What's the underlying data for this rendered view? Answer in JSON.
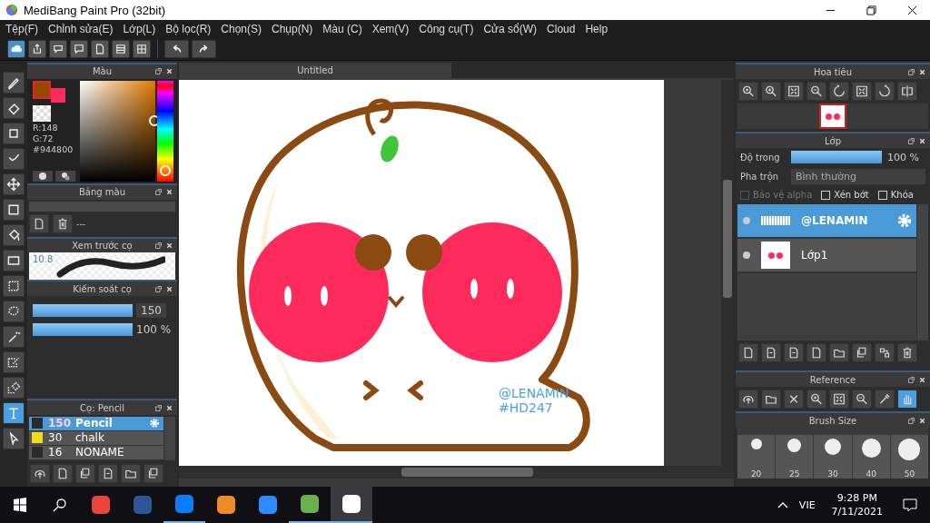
{
  "window": {
    "title": "MediBang Paint Pro (32bit)"
  },
  "menu": [
    "Tệp(F)",
    "Chỉnh sửa(E)",
    "Lớp(L)",
    "Bộ lọc(R)",
    "Chọn(S)",
    "Chụp(N)",
    "Màu (C)",
    "Xem(V)",
    "Công cụ(T)",
    "Cửa sổ(W)",
    "Cloud",
    "Help"
  ],
  "tools": [
    {
      "kind": "brush",
      "selected": false
    },
    {
      "kind": "eraser",
      "selected": false
    },
    {
      "kind": "square",
      "selected": false
    },
    {
      "kind": "dots",
      "selected": false
    },
    {
      "kind": "move",
      "selected": false
    },
    {
      "kind": "fill",
      "selected": false
    },
    {
      "kind": "bucket",
      "selected": false
    },
    {
      "kind": "gradient",
      "selected": false
    },
    {
      "kind": "select",
      "selected": false
    },
    {
      "kind": "lasso",
      "selected": false
    },
    {
      "kind": "wand",
      "selected": false
    },
    {
      "kind": "selpen",
      "selected": false
    },
    {
      "kind": "selerase",
      "selected": false
    },
    {
      "kind": "text",
      "selected": true
    },
    {
      "kind": "operation",
      "selected": false
    }
  ],
  "color_panel": {
    "title": "Màu",
    "r": "R:148",
    "g": "G:72",
    "hex": "#944800",
    "color": "#944800",
    "hue": {
      "level": 0.04
    }
  },
  "palette_panel": {
    "title": "Bảng màu",
    "name": "---"
  },
  "brush_preview": {
    "title": "Xem trước cọ",
    "size": "10.8"
  },
  "brush_control": {
    "title": "Kiếm soát cọ",
    "sliders": [
      {
        "kind": "box",
        "level": 1,
        "value": "150"
      },
      {
        "kind": "plain",
        "level": 1,
        "value": "100 %"
      }
    ]
  },
  "brushes": {
    "title": "Cọ: Pencil",
    "items": [
      {
        "size": "150",
        "name": "Pencil",
        "color": "#2b2b2b",
        "selected": true
      },
      {
        "size": "30",
        "name": "chalk",
        "color": "#f2dc17",
        "selected": false
      },
      {
        "size": "16",
        "name": "NONAME",
        "color": "#2b2b2b",
        "selected": false
      }
    ]
  },
  "canvas": {
    "tab": "Untitled",
    "texts": [
      "@LENAMIN",
      "#HD247"
    ]
  },
  "navigator": {
    "title": "Hoa tiêu"
  },
  "layer_panel": {
    "title": "Lớp",
    "opacity_label": "Độ trong",
    "opacity": {
      "level": 1,
      "value": "100 %"
    },
    "blend_label": "Pha trộn",
    "blend": "Bình thường",
    "options": [
      {
        "label": "Bảo vệ alpha",
        "checked": false,
        "disabled": true
      },
      {
        "label": "Xén bớt",
        "checked": false,
        "disabled": false
      },
      {
        "label": "Khóa",
        "checked": false,
        "disabled": false
      }
    ],
    "layers": [
      {
        "name": "@LENAMIN",
        "kind": "text",
        "selected": true
      },
      {
        "name": "Lớp1",
        "kind": "art",
        "selected": false
      }
    ]
  },
  "reference": {
    "title": "Reference"
  },
  "brush_size": {
    "title": "Brush Size",
    "sizes": [
      "20",
      "25",
      "30",
      "40",
      "50"
    ]
  },
  "taskbar": {
    "apps": [
      {
        "kind": "chrome",
        "running": false,
        "selected": false
      },
      {
        "kind": "word",
        "running": false,
        "selected": false
      },
      {
        "kind": "zalo",
        "running": true,
        "selected": false
      },
      {
        "kind": "pdf",
        "running": false,
        "selected": false
      },
      {
        "kind": "zoom",
        "running": false,
        "selected": false
      },
      {
        "kind": "green",
        "running": true,
        "selected": false
      },
      {
        "kind": "medibang",
        "running": true,
        "selected": true
      }
    ],
    "lang": "VIE",
    "time": "9:28 PM",
    "date": "7/11/2021"
  }
}
